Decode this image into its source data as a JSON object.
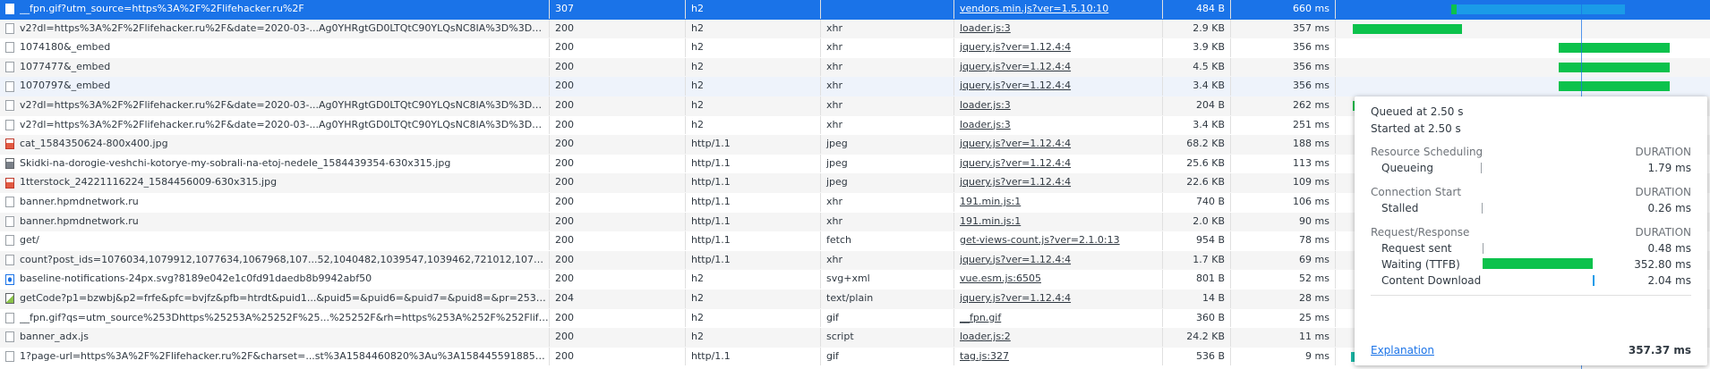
{
  "colors": {
    "selected": "#1a73e8",
    "waiting": "#0cc24c",
    "download": "#1a9be8"
  },
  "rows": [
    {
      "name": "__fpn.gif?utm_source=https%3A%2F%2Flifehacker.ru%2F",
      "status": "307",
      "protocol": "h2",
      "type": "",
      "initiator": "vendors.min.js?ver=1.5.10:10",
      "size": "484 B",
      "time": "660 ms",
      "icon": "doc-icon"
    },
    {
      "name": "v2?dl=https%3A%2F%2Flifehacker.ru%2F&date=2020-03-...Ag0YHRgtGD0LTQtC90YLQsNC8IA%3D%3D&utf...",
      "status": "200",
      "protocol": "h2",
      "type": "xhr",
      "initiator": "loader.js:3",
      "size": "2.9 KB",
      "time": "357 ms",
      "icon": "doc-icon"
    },
    {
      "name": "1074180&_embed",
      "status": "200",
      "protocol": "h2",
      "type": "xhr",
      "initiator": "jquery.js?ver=1.12.4:4",
      "size": "3.9 KB",
      "time": "356 ms",
      "icon": "doc-icon"
    },
    {
      "name": "1077477&_embed",
      "status": "200",
      "protocol": "h2",
      "type": "xhr",
      "initiator": "jquery.js?ver=1.12.4:4",
      "size": "4.5 KB",
      "time": "356 ms",
      "icon": "doc-icon"
    },
    {
      "name": "1070797&_embed",
      "status": "200",
      "protocol": "h2",
      "type": "xhr",
      "initiator": "jquery.js?ver=1.12.4:4",
      "size": "3.4 KB",
      "time": "356 ms",
      "icon": "doc-icon"
    },
    {
      "name": "v2?dl=https%3A%2F%2Flifehacker.ru%2F&date=2020-03-...Ag0YHRgtGD0LTQtC90YLQsNC8IA%3D%3D&utf...",
      "status": "200",
      "protocol": "h2",
      "type": "xhr",
      "initiator": "loader.js:3",
      "size": "204 B",
      "time": "262 ms",
      "icon": "doc-icon"
    },
    {
      "name": "v2?dl=https%3A%2F%2Flifehacker.ru%2F&date=2020-03-...Ag0YHRgtGD0LTQtC90YLQsNC8IA%3D%3D&utf...",
      "status": "200",
      "protocol": "h2",
      "type": "xhr",
      "initiator": "loader.js:3",
      "size": "3.4 KB",
      "time": "251 ms",
      "icon": "doc-icon"
    },
    {
      "name": "cat_1584350624-800x400.jpg",
      "status": "200",
      "protocol": "http/1.1",
      "type": "jpeg",
      "initiator": "jquery.js?ver=1.12.4:4",
      "size": "68.2 KB",
      "time": "188 ms",
      "icon": "image-icon"
    },
    {
      "name": "Skidki-na-dorogie-veshchi-kotorye-my-sobrali-na-etoj-nedele_1584439354-630x315.jpg",
      "status": "200",
      "protocol": "http/1.1",
      "type": "jpeg",
      "initiator": "jquery.js?ver=1.12.4:4",
      "size": "25.6 KB",
      "time": "113 ms",
      "icon": "image-icon"
    },
    {
      "name": "1tterstock_24221116224_1584456009-630x315.jpg",
      "status": "200",
      "protocol": "http/1.1",
      "type": "jpeg",
      "initiator": "jquery.js?ver=1.12.4:4",
      "size": "22.6 KB",
      "time": "109 ms",
      "icon": "image-icon"
    },
    {
      "name": "banner.hpmdnetwork.ru",
      "status": "200",
      "protocol": "http/1.1",
      "type": "xhr",
      "initiator": "191.min.js:1",
      "size": "740 B",
      "time": "106 ms",
      "icon": "doc-icon"
    },
    {
      "name": "banner.hpmdnetwork.ru",
      "status": "200",
      "protocol": "http/1.1",
      "type": "xhr",
      "initiator": "191.min.js:1",
      "size": "2.0 KB",
      "time": "90 ms",
      "icon": "doc-icon"
    },
    {
      "name": "get/",
      "status": "200",
      "protocol": "http/1.1",
      "type": "fetch",
      "initiator": "get-views-count.js?ver=2.1.0:13",
      "size": "954 B",
      "time": "78 ms",
      "icon": "doc-icon"
    },
    {
      "name": "count?post_ids=1076034,1079912,1077634,1067968,107...52,1040482,1039547,1039462,721012,1077397,...",
      "status": "200",
      "protocol": "http/1.1",
      "type": "xhr",
      "initiator": "jquery.js?ver=1.12.4:4",
      "size": "1.7 KB",
      "time": "69 ms",
      "icon": "doc-icon"
    },
    {
      "name": "baseline-notifications-24px.svg?8189e042e1c0fd91daedb8b9942abf50",
      "status": "200",
      "protocol": "h2",
      "type": "svg+xml",
      "initiator": "vue.esm.js:6505",
      "size": "801 B",
      "time": "52 ms",
      "icon": "svg-icon"
    },
    {
      "name": "getCode?p1=bzwbj&p2=frfe&pfc=bvjfz&pfb=htrdt&puid1...&puid5=&puid6=&puid7=&puid8=&pr=2530622337...",
      "status": "204",
      "protocol": "h2",
      "type": "text/plain",
      "initiator": "jquery.js?ver=1.12.4:4",
      "size": "14 B",
      "time": "28 ms",
      "icon": "code-icon"
    },
    {
      "name": "__fpn.gif?qs=utm_source%253Dhttps%25253A%25252F%25...%25252F&rh=https%253A%252F%252Flifehac...",
      "status": "200",
      "protocol": "h2",
      "type": "gif",
      "initiator": "__fpn.gif",
      "size": "360 B",
      "time": "25 ms",
      "icon": "doc-icon"
    },
    {
      "name": "banner_adx.js",
      "status": "200",
      "protocol": "h2",
      "type": "script",
      "initiator": "loader.js:2",
      "size": "24.2 KB",
      "time": "11 ms",
      "icon": "doc-icon"
    },
    {
      "name": "1?page-url=https%3A%2F%2Flifehacker.ru%2F&charset=...st%3A1584460820%3Au%3A15844559188563325...",
      "status": "200",
      "protocol": "http/1.1",
      "type": "gif",
      "initiator": "tag.js:327",
      "size": "536 B",
      "time": "9 ms",
      "icon": "doc-icon"
    }
  ],
  "timing_popover": {
    "queued": "Queued at 2.50 s",
    "started": "Started at 2.50 s",
    "sections": [
      {
        "title": "Resource Scheduling",
        "duration_label": "DURATION",
        "items": [
          {
            "label": "Queueing",
            "value": "1.79 ms"
          }
        ]
      },
      {
        "title": "Connection Start",
        "duration_label": "DURATION",
        "items": [
          {
            "label": "Stalled",
            "value": "0.26 ms"
          }
        ]
      },
      {
        "title": "Request/Response",
        "duration_label": "DURATION",
        "items": [
          {
            "label": "Request sent",
            "value": "0.48 ms"
          },
          {
            "label": "Waiting (TTFB)",
            "value": "352.80 ms"
          },
          {
            "label": "Content Download",
            "value": "2.04 ms"
          }
        ]
      }
    ],
    "explanation": "Explanation",
    "total": "357.37 ms"
  }
}
